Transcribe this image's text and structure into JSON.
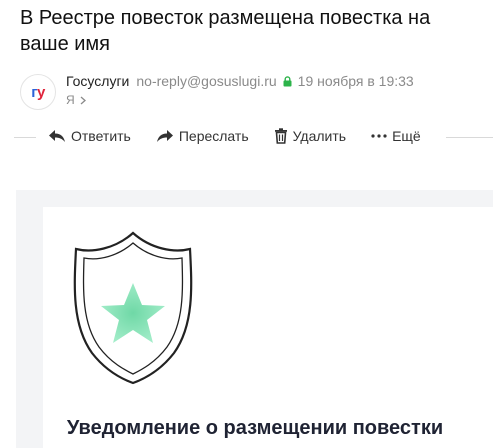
{
  "email": {
    "subject": "В Реестре повесток размещена повестка на ваше имя",
    "avatar_text_first": "г",
    "avatar_text_second": "у",
    "sender_name": "Госуслуги",
    "sender_email": "no-reply@gosuslugi.ru",
    "date": "19 ноября в 19:33",
    "recipient": "Я"
  },
  "toolbar": {
    "reply_label": "Ответить",
    "forward_label": "Переслать",
    "delete_label": "Удалить",
    "more_label": "Ещё"
  },
  "body": {
    "title": "Уведомление о размещении повестки"
  },
  "colors": {
    "brand_blue": "#2b63d9",
    "brand_red": "#e0243c",
    "lock_green": "#2cb34a",
    "star_green": "#7ee0b2"
  }
}
